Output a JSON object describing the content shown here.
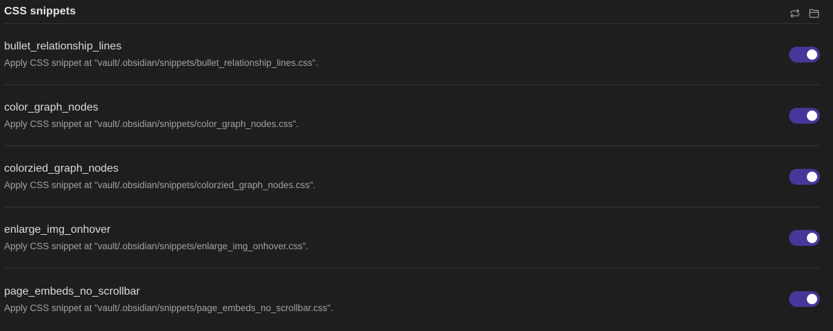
{
  "section": {
    "title": "CSS snippets",
    "actions": [
      {
        "name": "reload-icon",
        "label": "Reload snippets"
      },
      {
        "name": "folder-icon",
        "label": "Open snippets folder"
      }
    ]
  },
  "accent_color": "#483699",
  "snippets": [
    {
      "name": "bullet_relationship_lines",
      "description": "Apply CSS snippet at \"vault/.obsidian/snippets/bullet_relationship_lines.css\".",
      "enabled": true
    },
    {
      "name": "color_graph_nodes",
      "description": "Apply CSS snippet at \"vault/.obsidian/snippets/color_graph_nodes.css\".",
      "enabled": true
    },
    {
      "name": "colorzied_graph_nodes",
      "description": "Apply CSS snippet at \"vault/.obsidian/snippets/colorzied_graph_nodes.css\".",
      "enabled": true
    },
    {
      "name": "enlarge_img_onhover",
      "description": "Apply CSS snippet at \"vault/.obsidian/snippets/enlarge_img_onhover.css\".",
      "enabled": true
    },
    {
      "name": "page_embeds_no_scrollbar",
      "description": "Apply CSS snippet at \"vault/.obsidian/snippets/page_embeds_no_scrollbar.css\".",
      "enabled": true
    }
  ]
}
